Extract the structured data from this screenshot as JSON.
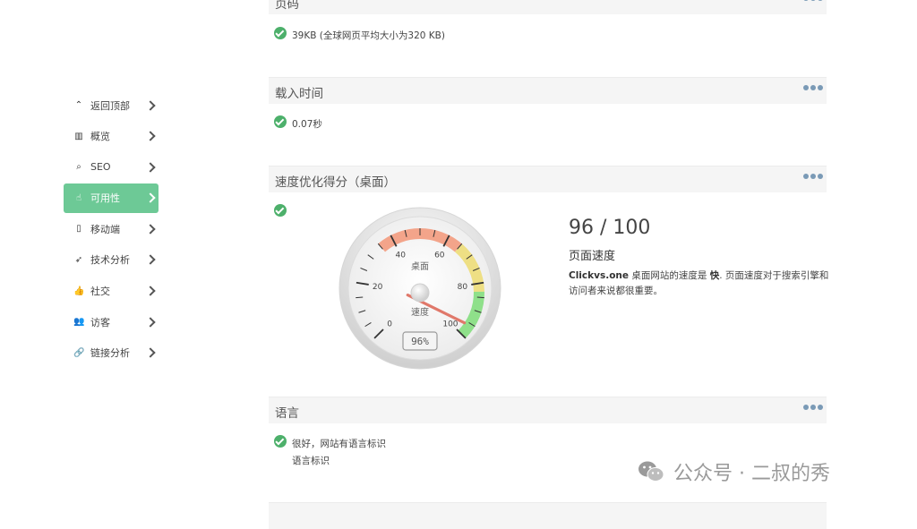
{
  "sidebar": {
    "items": [
      {
        "label": "返回顶部",
        "icon": "chevron-up-icon",
        "glyph": "⌃"
      },
      {
        "label": "概览",
        "icon": "bar-chart-icon",
        "glyph": "▥"
      },
      {
        "label": "SEO",
        "icon": "search-icon",
        "glyph": "⌕"
      },
      {
        "label": "可用性",
        "icon": "hand-pointer-icon",
        "glyph": "☝",
        "active": true
      },
      {
        "label": "移动端",
        "icon": "mobile-icon",
        "glyph": "▯"
      },
      {
        "label": "技术分析",
        "icon": "rocket-icon",
        "glyph": "➶"
      },
      {
        "label": "社交",
        "icon": "thumbs-up-icon",
        "glyph": "👍"
      },
      {
        "label": "访客",
        "icon": "users-icon",
        "glyph": "👥"
      },
      {
        "label": "链接分析",
        "icon": "link-icon",
        "glyph": "🔗"
      }
    ]
  },
  "sections": {
    "page_size": {
      "title": "页码",
      "value": "39KB (全球网页平均大小为320 KB)"
    },
    "load_time": {
      "title": "载入时间",
      "value": "0.07秒"
    },
    "speed": {
      "title": "速度优化得分（桌面）"
    },
    "language": {
      "title": "语言",
      "value": "很好，网站有语言标识",
      "sub": "语言标识"
    }
  },
  "gauge": {
    "label_top": "桌面",
    "label_bottom": "速度",
    "readout": "96%",
    "value": 96,
    "ticks": [
      "0",
      "20",
      "40",
      "60",
      "80",
      "100"
    ]
  },
  "score": {
    "value": "96 / 100",
    "label": "页面速度",
    "desc_site": "Clickvs.one",
    "desc_1": " 桌面网站的速度是 ",
    "desc_fast": "快",
    "desc_2": ". 页面速度对于搜索引擎和访问者来说都很重要。"
  },
  "watermark": {
    "text": "公众号 · 二叔的秀"
  },
  "colors": {
    "accent": "#6dc996",
    "check": "#4db06b",
    "dots": "#7a9ab6"
  }
}
